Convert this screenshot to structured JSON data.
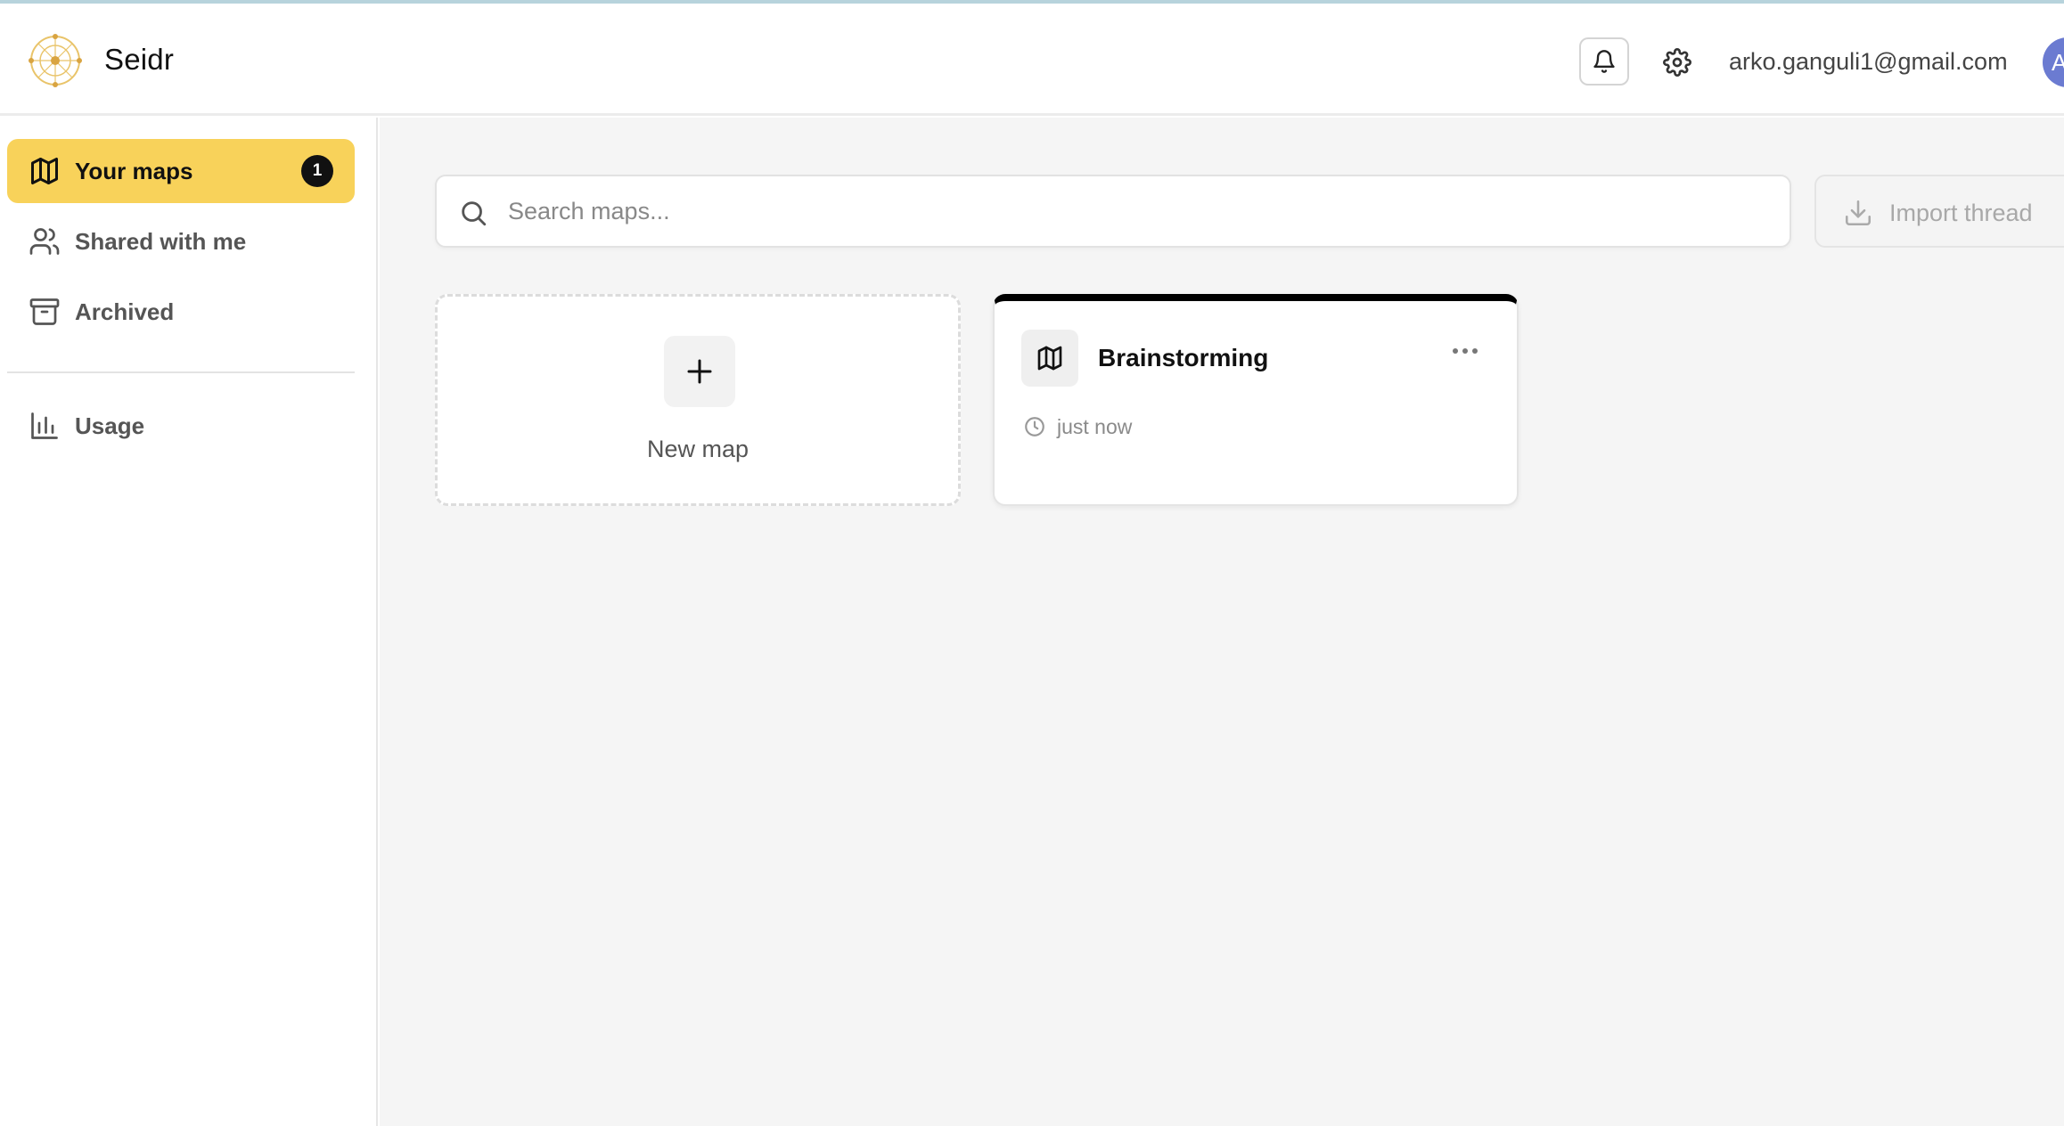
{
  "header": {
    "app_name": "Seidr",
    "user_email": "arko.ganguli1@gmail.com",
    "avatar_initial": "A"
  },
  "sidebar": {
    "items": [
      {
        "label": "Your maps",
        "icon": "map-icon",
        "active": true,
        "badge": "1"
      },
      {
        "label": "Shared with me",
        "icon": "users-icon",
        "active": false
      },
      {
        "label": "Archived",
        "icon": "archive-icon",
        "active": false
      },
      {
        "label": "Usage",
        "icon": "bar-chart-icon",
        "active": false
      }
    ]
  },
  "main": {
    "search": {
      "placeholder": "Search maps...",
      "value": ""
    },
    "import_button": {
      "label": "Import thread"
    },
    "new_map": {
      "label": "New map"
    },
    "maps": [
      {
        "title": "Brainstorming",
        "time": "just now"
      }
    ]
  },
  "colors": {
    "accent": "#f8d25a",
    "badge": "#111111",
    "avatar": "#6b7bd1",
    "card_top_border": "#000000",
    "main_background": "#f5f5f5"
  }
}
